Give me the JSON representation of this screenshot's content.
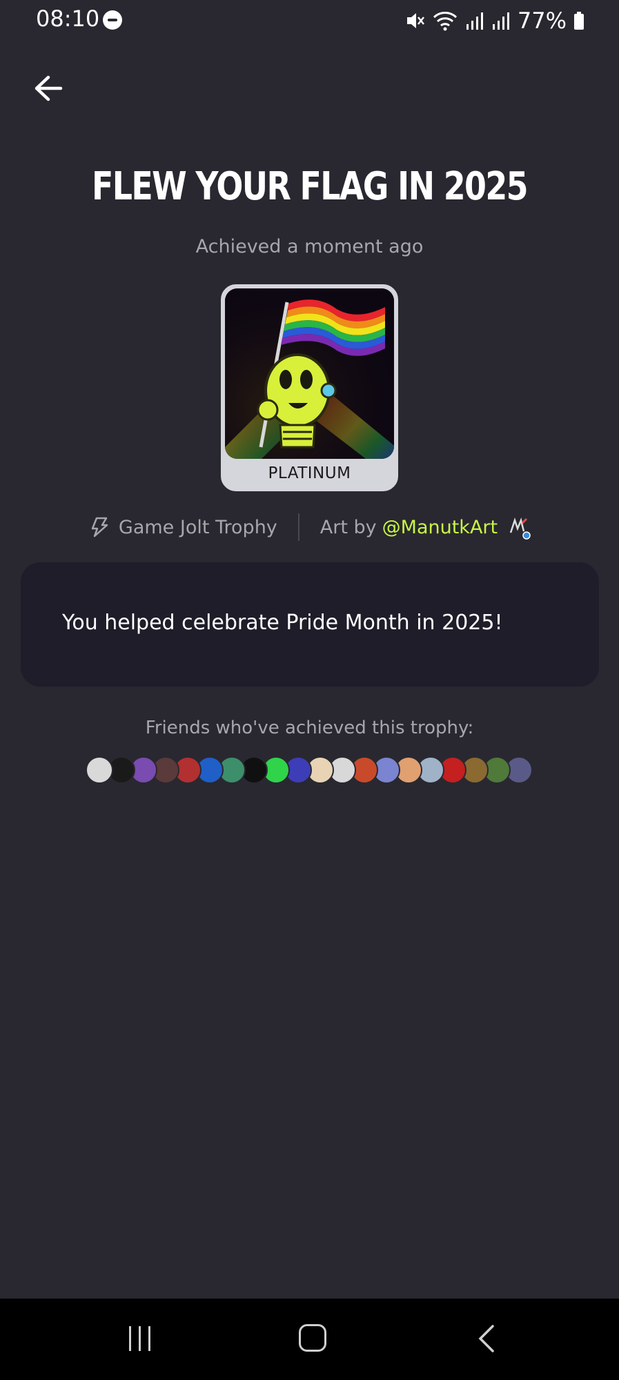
{
  "status_bar": {
    "time": "08:10",
    "battery": "77%"
  },
  "trophy": {
    "title": "FLEW YOUR FLAG IN 2025",
    "achieved": "Achieved a moment ago",
    "tier": "PLATINUM",
    "source": "Game Jolt Trophy",
    "art_prefix": "Art by",
    "artist": "@ManutkArt",
    "description": "You helped celebrate Pride Month in 2025!"
  },
  "friends": {
    "label": "Friends who've achieved this trophy:",
    "avatar_colors": [
      "#d9d9d9",
      "#1a1a1a",
      "#7a4bb0",
      "#5a3a3a",
      "#b23030",
      "#1f5fc7",
      "#3c8f6a",
      "#101010",
      "#2fd44a",
      "#3d3db8",
      "#e8d4b4",
      "#d8d8d8",
      "#c84a2a",
      "#7a84d0",
      "#e0a070",
      "#9fb2c8",
      "#c42020",
      "#8a6a30",
      "#4f7a3a",
      "#5a5a88"
    ]
  },
  "icons": {
    "back": "arrow-left-icon",
    "bolt": "game-jolt-bolt-icon"
  },
  "colors": {
    "background": "#292830",
    "card": "#1f1d29",
    "accent": "#c8f546",
    "muted_text": "#a7a6ad"
  }
}
